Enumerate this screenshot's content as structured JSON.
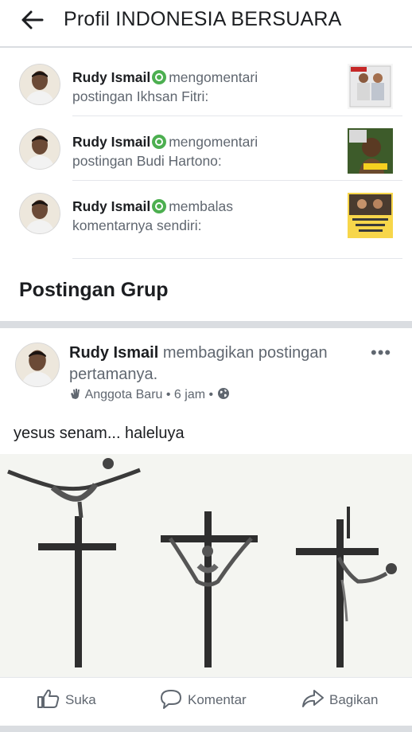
{
  "header": {
    "back_icon": "arrow-left-icon",
    "title": "Profil INDONESIA BERSUARA"
  },
  "activities": [
    {
      "name": "Rudy Ismail",
      "action": "mengomentari",
      "target": "postingan Ikhsan Fitri:"
    },
    {
      "name": "Rudy Ismail",
      "action": "mengomentari",
      "target": "postingan Budi Hartono:"
    },
    {
      "name": "Rudy Ismail",
      "action": "membalas",
      "target": "komentarnya sendiri:"
    }
  ],
  "section": {
    "title": "Postingan Grup"
  },
  "post": {
    "author": "Rudy Ismail",
    "action": "membagikan postingan pertamanya.",
    "badge": "Anggota Baru",
    "time": "6 jam",
    "text": "yesus senam... haleluya"
  },
  "actions": {
    "like": "Suka",
    "comment": "Komentar",
    "share": "Bagikan"
  },
  "colors": {
    "text": "#1c1e21",
    "secondary": "#606770",
    "divider": "#dadde1",
    "active_badge": "#4caf50"
  }
}
